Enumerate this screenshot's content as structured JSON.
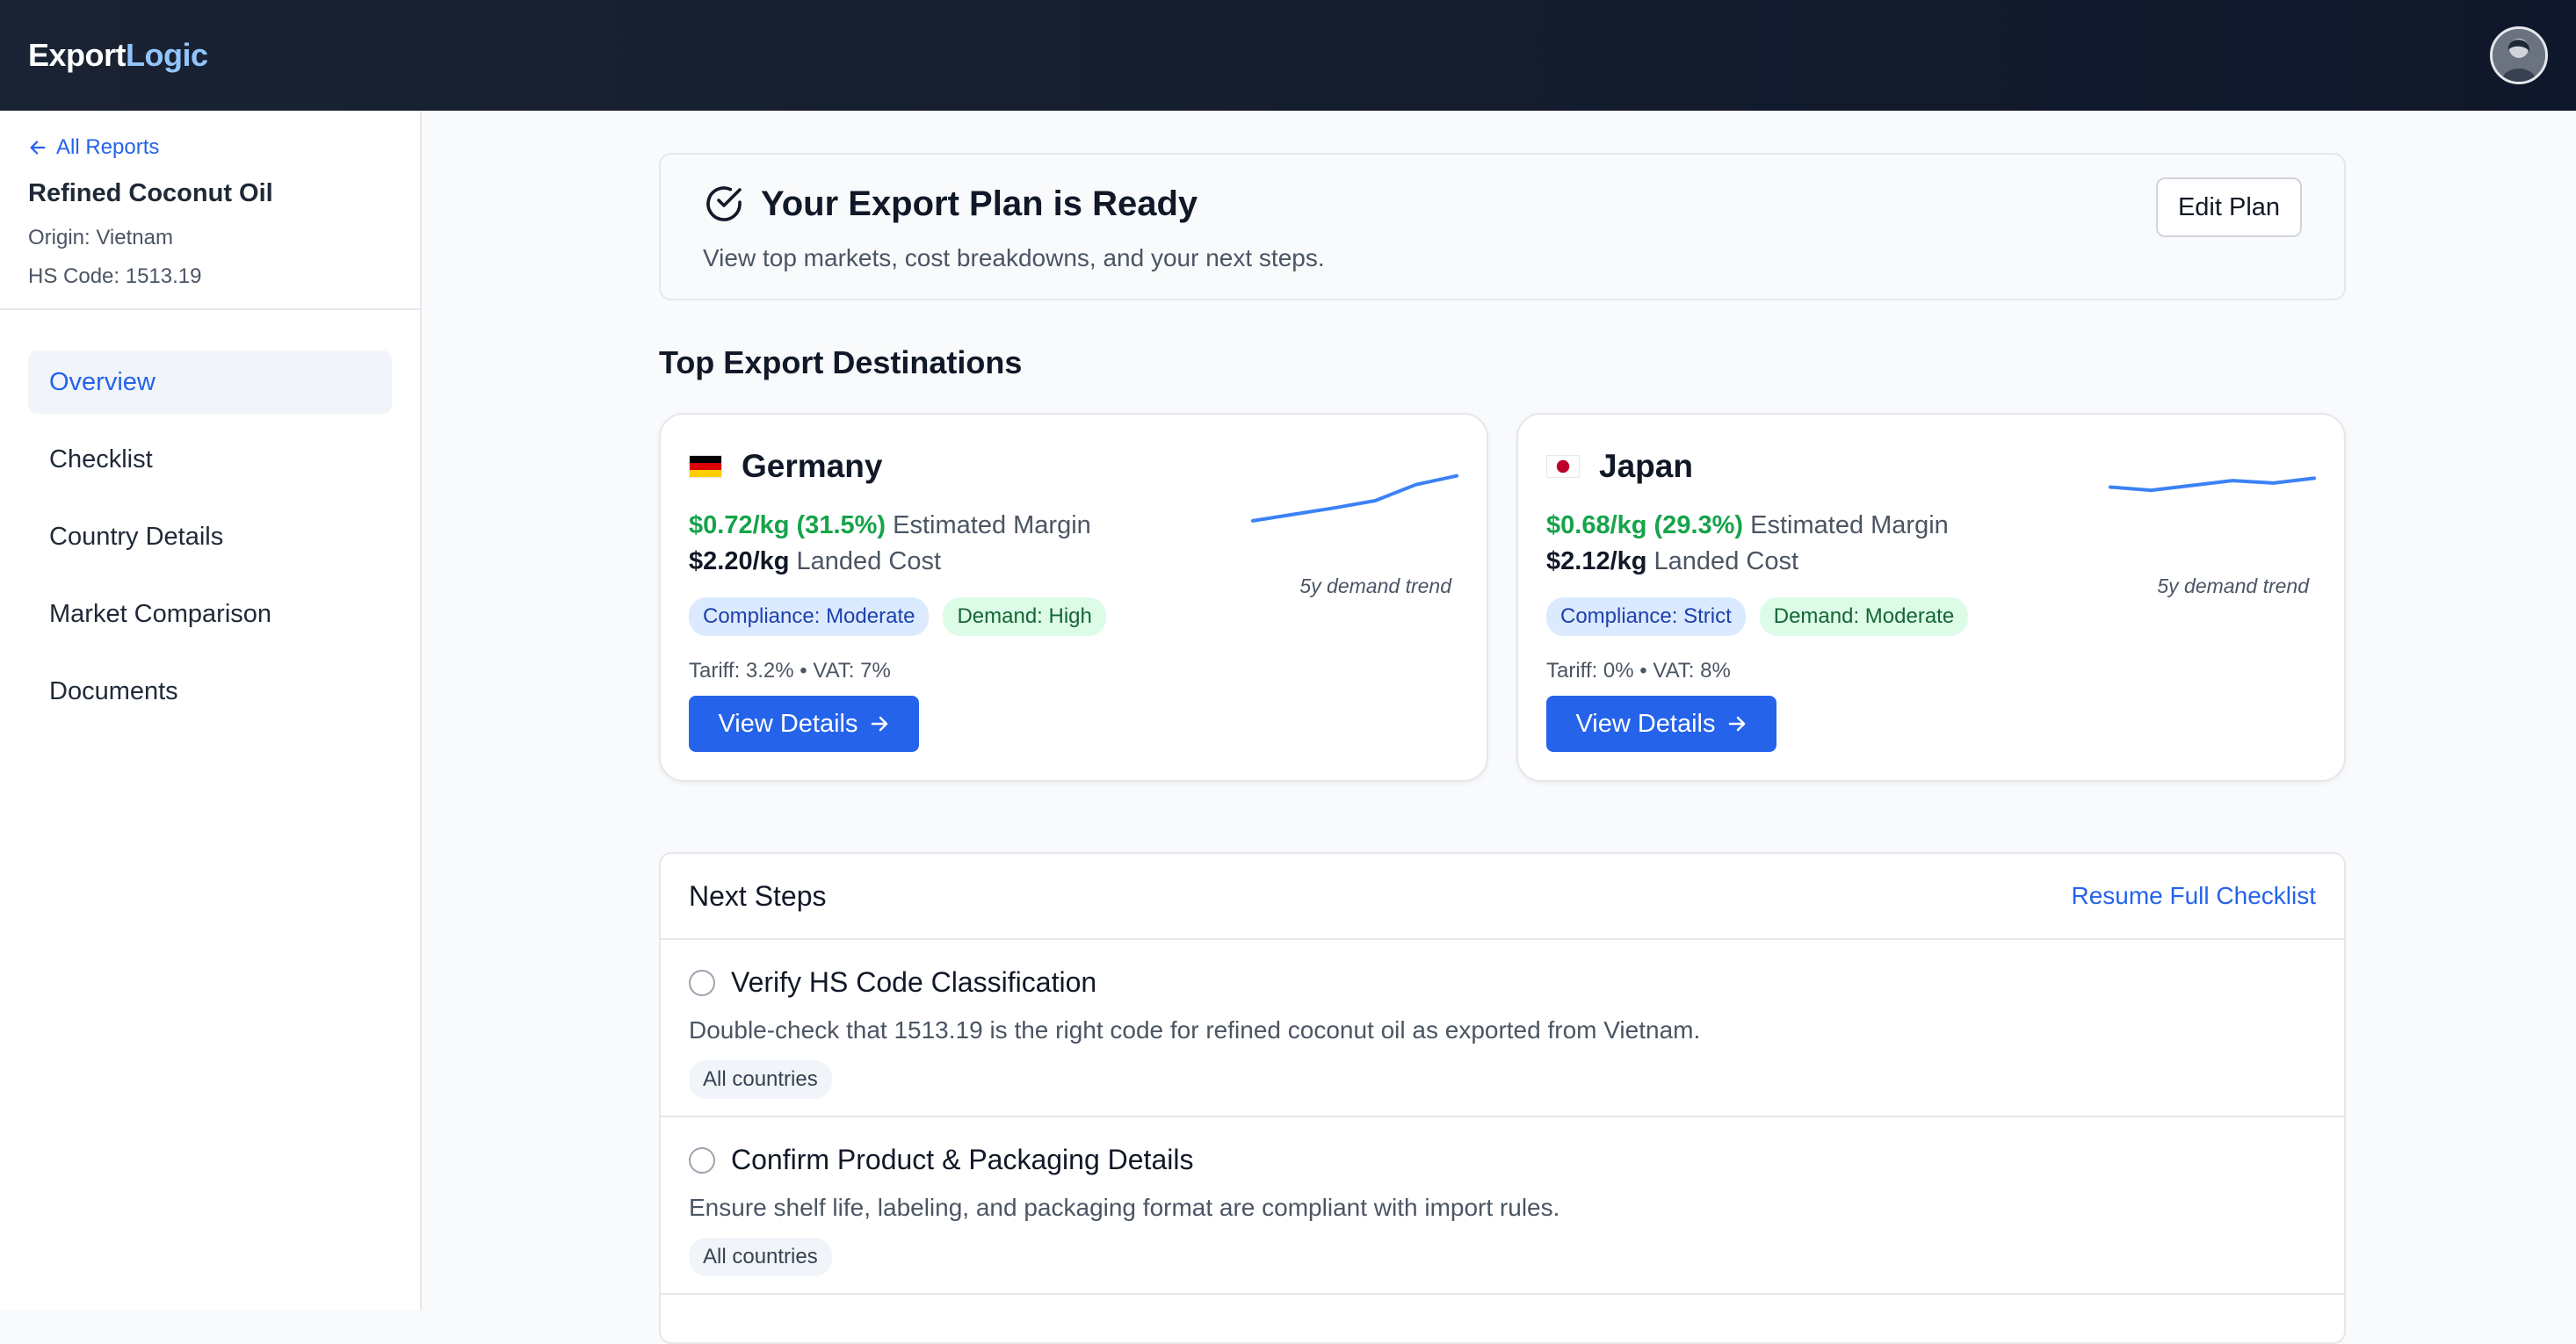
{
  "app": {
    "brand_part1": "Export",
    "brand_part2": "Logic"
  },
  "sidebar": {
    "back_link": "All Reports",
    "product_name": "Refined Coconut Oil",
    "origin": "Origin: Vietnam",
    "hs_code": "HS Code: 1513.19",
    "nav": [
      {
        "label": "Overview",
        "active": true
      },
      {
        "label": "Checklist"
      },
      {
        "label": "Country Details"
      },
      {
        "label": "Market Comparison"
      },
      {
        "label": "Documents"
      }
    ]
  },
  "ready": {
    "title": "Your Export Plan is Ready",
    "subtitle": "View top markets, cost breakdowns, and your next steps.",
    "edit_label": "Edit Plan"
  },
  "destinations": {
    "title": "Top Export Destinations",
    "cards": [
      {
        "country": "Germany",
        "flag": "🇩🇪",
        "margin_value": "$0.72/kg (31.5%)",
        "margin_label": "Estimated Margin",
        "landed_value": "$2.20/kg",
        "landed_label": "Landed Cost",
        "compliance": "Compliance: Moderate",
        "demand": "Demand: High",
        "tariff": "Tariff: 3.2% • VAT: 7%",
        "button": "View Details",
        "trend_label": "5y demand trend",
        "trend": [
          10,
          18,
          26,
          35,
          55,
          66
        ]
      },
      {
        "country": "Japan",
        "flag": "🇯🇵",
        "margin_value": "$0.68/kg (29.3%)",
        "margin_label": "Estimated Margin",
        "landed_value": "$2.12/kg",
        "landed_label": "Landed Cost",
        "compliance": "Compliance: Strict",
        "demand": "Demand: Moderate",
        "tariff": "Tariff: 0% • VAT: 8%",
        "button": "View Details",
        "trend_label": "5y demand trend",
        "trend": [
          52,
          48,
          54,
          60,
          57,
          63
        ]
      }
    ]
  },
  "next_steps": {
    "title": "Next Steps",
    "resume_link": "Resume Full Checklist",
    "items": [
      {
        "title": "Verify HS Code Classification",
        "desc": "Double-check that 1513.19 is the right code for refined coconut oil as exported from Vietnam.",
        "tag": "All countries"
      },
      {
        "title": "Confirm Product & Packaging Details",
        "desc": "Ensure shelf life, labeling, and packaging format are compliant with import rules.",
        "tag": "All countries"
      }
    ]
  },
  "icons": {
    "back": "arrow-left-icon",
    "ready": "check-circle-icon",
    "button_arrow": "arrow-right-icon"
  }
}
